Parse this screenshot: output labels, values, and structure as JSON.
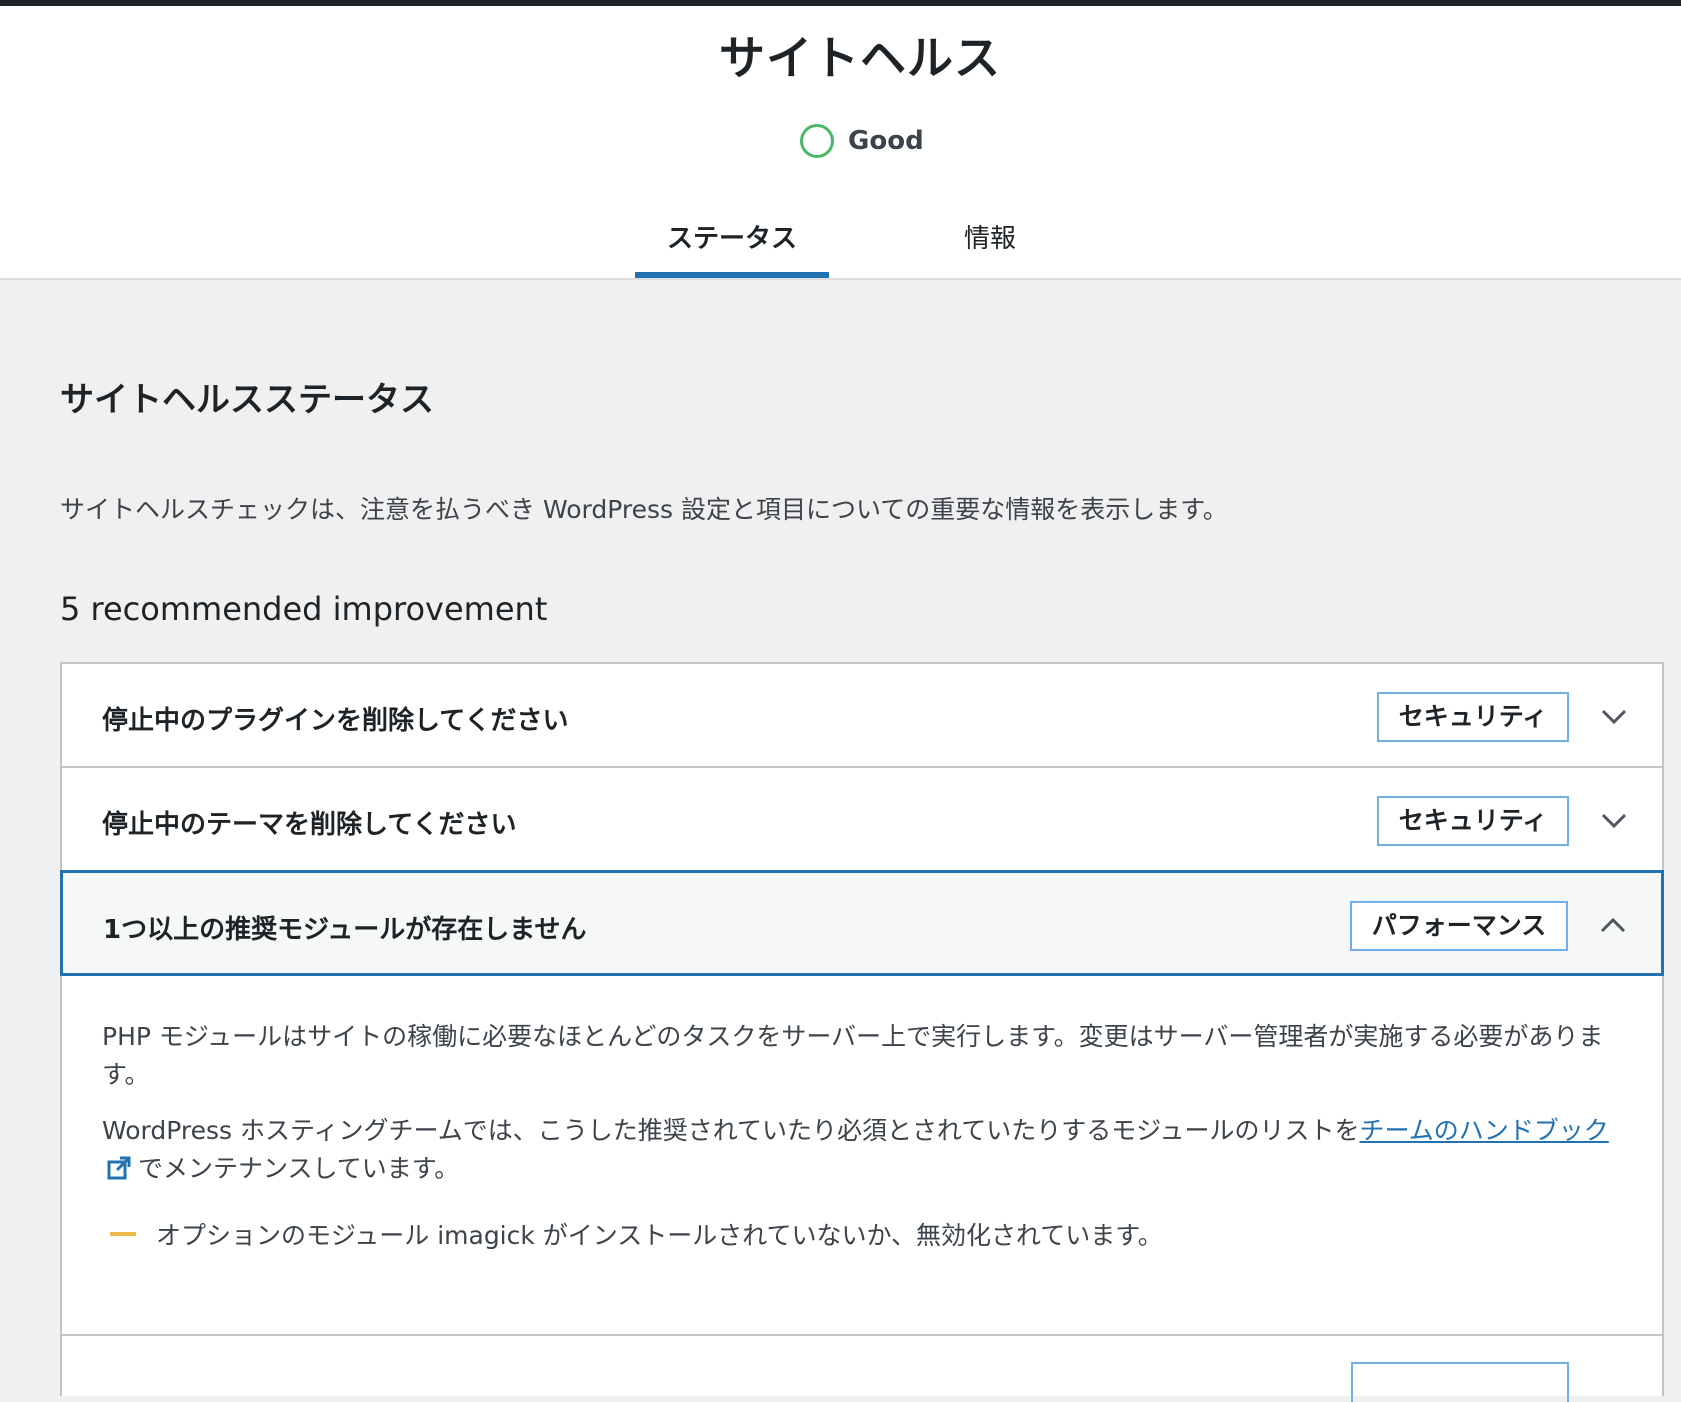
{
  "page": {
    "title": "サイトヘルス",
    "status_text": "Good",
    "status_color": "#4ab866",
    "accent_color": "#2271b1"
  },
  "tabs": [
    {
      "label": "ステータス",
      "active": true
    },
    {
      "label": "情報",
      "active": false
    }
  ],
  "main": {
    "section_title": "サイトヘルスステータス",
    "description": "サイトヘルスチェックは、注意を払うべき WordPress 設定と項目についての重要な情報を表示します。",
    "improvements_count": "5 recommended improvement"
  },
  "accordion": [
    {
      "title": "停止中のプラグインを削除してください",
      "badge": "セキュリティ",
      "expanded": false,
      "icon": "chevron-down-icon"
    },
    {
      "title": "停止中のテーマを削除してください",
      "badge": "セキュリティ",
      "expanded": false,
      "icon": "chevron-down-icon"
    },
    {
      "title": "1つ以上の推奨モジュールが存在しません",
      "badge": "パフォーマンス",
      "expanded": true,
      "icon": "chevron-up-icon",
      "body": {
        "p1": "PHP モジュールはサイトの稼働に必要なほとんどのタスクをサーバー上で実行します。変更はサーバー管理者が実施する必要があります。",
        "p2_before": "WordPress ホスティングチームでは、こうした推奨されていたり必須とされていたりするモジュールのリストを",
        "p2_link": "チームのハンドブック",
        "p2_after": "でメンテナンスしています。",
        "warning": "オプションのモジュール imagick がインストールされていないか、無効化されています。",
        "warning_color": "#f0b849"
      }
    }
  ]
}
